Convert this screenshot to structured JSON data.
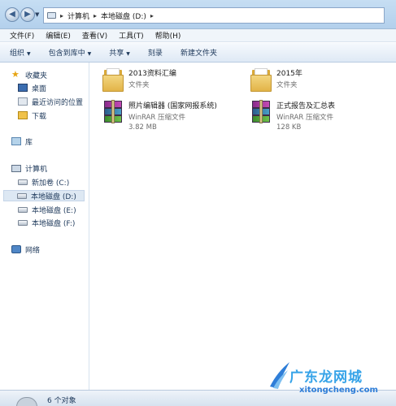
{
  "address_bar": {
    "crumbs": [
      "计算机",
      "本地磁盘 (D:)"
    ]
  },
  "menu": [
    "文件(F)",
    "编辑(E)",
    "查看(V)",
    "工具(T)",
    "帮助(H)"
  ],
  "toolbar": {
    "organize": "组织",
    "include_in_library": "包含到库中",
    "share": "共享",
    "burn": "刻录",
    "new_folder": "新建文件夹"
  },
  "nav": {
    "favorites": "收藏夹",
    "desktop": "桌面",
    "recent": "最近访问的位置",
    "downloads": "下载",
    "libraries": "库",
    "computer": "计算机",
    "drive_c": "新加卷 (C:)",
    "drive_d": "本地磁盘 (D:)",
    "drive_e": "本地磁盘 (E:)",
    "drive_f": "本地磁盘 (F:)",
    "network": "网络"
  },
  "files": [
    {
      "name": "2013资料汇编",
      "type": "文件夹",
      "size": "",
      "icon": "folder-icon"
    },
    {
      "name": "2015年",
      "type": "文件夹",
      "size": "",
      "icon": "folder-icon"
    },
    {
      "name": "照片编辑器 (国家网报系统)",
      "type": "WinRAR 压缩文件",
      "size": "3.82 MB",
      "icon": "winrar-icon"
    },
    {
      "name": "正式报告及汇总表",
      "type": "WinRAR 压缩文件",
      "size": "128 KB",
      "icon": "winrar-icon"
    }
  ],
  "status": {
    "count": "6 个对象"
  },
  "watermark": {
    "text_cn_prefix": "广东龙",
    "text_cn_suffix": "网城",
    "url": "xitongcheng.com"
  }
}
